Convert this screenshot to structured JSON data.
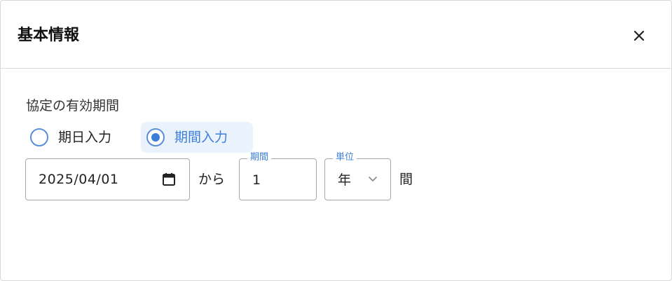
{
  "dialog": {
    "title": "基本情報",
    "close_icon": "close-icon"
  },
  "section": {
    "label": "協定の有効期間"
  },
  "radio": {
    "options": [
      {
        "label": "期日入力",
        "checked": false
      },
      {
        "label": "期間入力",
        "checked": true
      }
    ]
  },
  "date_input": {
    "value": "2025/04/01",
    "icon": "calendar-icon"
  },
  "from_text": "から",
  "period_input": {
    "label": "期間",
    "value": "1"
  },
  "unit_select": {
    "label": "単位",
    "value": "年",
    "icon": "chevron-down-icon"
  },
  "interval_text": "間",
  "colors": {
    "accent": "#3b7fd9",
    "selected_bg": "#eaf2fc",
    "border": "#a8a8a8"
  }
}
